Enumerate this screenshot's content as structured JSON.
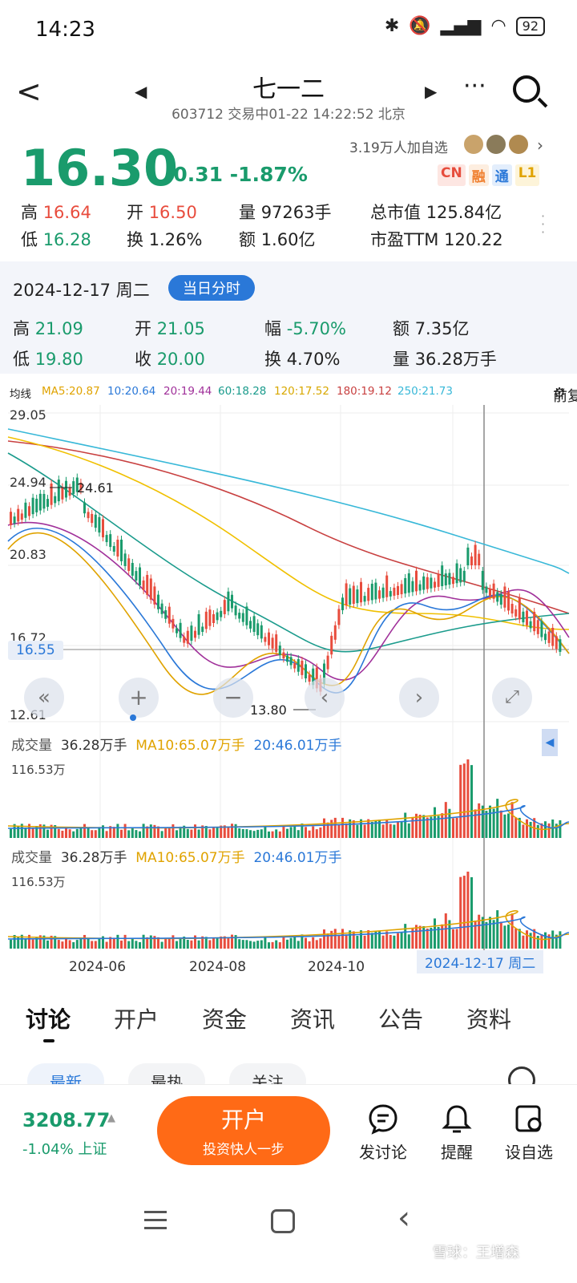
{
  "status": {
    "time": "14:23",
    "battery": "92"
  },
  "nav": {
    "back": "<",
    "title": "七一二",
    "subtitle": "603712 交易中01-22 14:22:52 北京",
    "more": "···"
  },
  "quote": {
    "price": "16.30",
    "change": "-0.31 -1.87%",
    "followers": "3.19万人加自选",
    "badges": [
      "CN",
      "融",
      "通",
      "L1"
    ],
    "stats": {
      "high_label": "高",
      "high": "16.64",
      "open_label": "开",
      "open": "16.50",
      "vol_label": "量",
      "vol": "97263手",
      "mcap_label": "总市值",
      "mcap": "125.84亿",
      "low_label": "低",
      "low": "16.28",
      "turn_label": "换",
      "turn": "1.26%",
      "amt_label": "额",
      "amt": "1.60亿",
      "pe_label": "市盈TTM",
      "pe": "120.22"
    }
  },
  "history": {
    "date": "2024-12-17 周二",
    "button": "当日分时",
    "high_label": "高",
    "high": "21.09",
    "open_label": "开",
    "open": "21.05",
    "amp_label": "幅",
    "amp": "-5.70%",
    "amt_label": "额",
    "amt": "7.35亿",
    "low_label": "低",
    "low": "19.80",
    "close_label": "收",
    "close": "20.00",
    "turn_label": "换",
    "turn": "4.70%",
    "vol_label": "量",
    "vol": "36.28万手"
  },
  "ma": {
    "label": "均线",
    "items": [
      "MA5:20.87",
      "10:20.64",
      "20:19.44",
      "60:18.28",
      "120:17.52",
      "180:19.12",
      "250:21.73"
    ],
    "colors": [
      "#e0a300",
      "#2a78d8",
      "#a0309a",
      "#1a9b8c",
      "#f0c000",
      "#c84040",
      "#38b8d8"
    ],
    "fuquan": "前复权"
  },
  "chart_data": {
    "type": "line",
    "price_axis": [
      "29.05",
      "24.94",
      "20.83",
      "16.72",
      "12.61"
    ],
    "current_price_label": "16.55",
    "max_label": "24.61",
    "min_label": "13.80",
    "x_labels": [
      "2024-06",
      "2024-08",
      "2024-10"
    ],
    "selected_date": "2024-12-17 周二",
    "volume_panels": [
      {
        "label": "成交量",
        "vol": "36.28万手",
        "ma10": "MA10:65.07万手",
        "ma20": "20:46.01万手",
        "max": "116.53万"
      },
      {
        "label": "成交量",
        "vol": "36.28万手",
        "ma10": "MA10:65.07万手",
        "ma20": "20:46.01万手",
        "max": "116.53万"
      }
    ]
  },
  "tabs": [
    "讨论",
    "开户",
    "资金",
    "资讯",
    "公告",
    "资料"
  ],
  "subtabs": [
    "最新",
    "最热",
    "关注"
  ],
  "bottom": {
    "index_value": "3208.77",
    "index_change": "-1.04% 上证",
    "open_main": "开户",
    "open_sub": "投资快人一步",
    "actions": [
      "发讨论",
      "提醒",
      "设自选"
    ]
  },
  "watermark": "雪球：王增森"
}
